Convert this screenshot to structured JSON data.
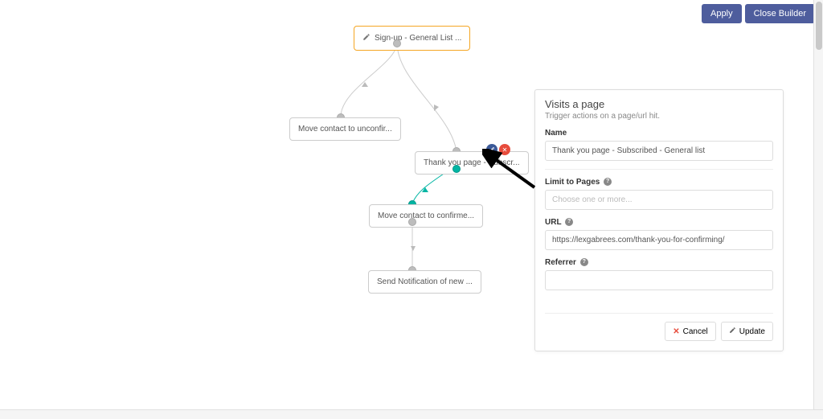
{
  "topbar": {
    "apply": "Apply",
    "close": "Close Builder"
  },
  "nodes": {
    "source": "Sign-up - General List ...",
    "unconfirmed": "Move contact to unconfir...",
    "thankyou": "Thank you page - Subscr...",
    "confirmed": "Move contact to confirme...",
    "notify": "Send Notification of new ..."
  },
  "panel": {
    "title": "Visits a page",
    "subtitle": "Trigger actions on a page/url hit.",
    "name_label": "Name",
    "name_value": "Thank you page - Subscribed - General list",
    "limit_label": "Limit to Pages",
    "limit_placeholder": "Choose one or more...",
    "url_label": "URL",
    "url_value": "https://lexgabrees.com/thank-you-for-confirming/",
    "referrer_label": "Referrer",
    "cancel": "Cancel",
    "update": "Update"
  }
}
